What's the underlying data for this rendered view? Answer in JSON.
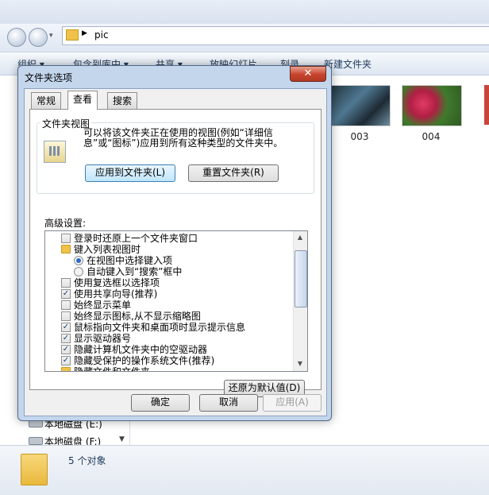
{
  "explorer": {
    "address": "pic",
    "toolbar": [
      "组织 ▾",
      "包含到库中 ▾",
      "共享 ▾",
      "放映幻灯片",
      "刻录",
      "新建文件夹"
    ],
    "thumbnails": [
      {
        "label": "003",
        "color": "#3a5b6e"
      },
      {
        "label": "004",
        "color": "#c22a4a"
      }
    ],
    "nav_items": [
      "本地磁盘 (E:)",
      "本地磁盘 (F:)"
    ],
    "status": "5 个对象"
  },
  "dialog": {
    "title": "文件夹选项",
    "close": "✕",
    "tabs": [
      "常规",
      "查看",
      "搜索"
    ],
    "active_tab": 1,
    "folder_view": {
      "legend": "文件夹视图",
      "description": "可以将该文件夹正在使用的视图(例如“详细信息”或“图标”)应用到所有这种类型的文件夹中。",
      "apply_button": "应用到文件夹(L)",
      "reset_button": "重置文件夹(R)"
    },
    "advanced_label": "高级设置:",
    "tree": [
      {
        "type": "checkbox",
        "checked": false,
        "indent": 0,
        "label": "登录时还原上一个文件夹窗口"
      },
      {
        "type": "folder",
        "indent": 0,
        "label": "键入列表视图时"
      },
      {
        "type": "radio",
        "checked": true,
        "indent": 1,
        "label": "在视图中选择键入项"
      },
      {
        "type": "radio",
        "checked": false,
        "indent": 1,
        "label": "自动键入到“搜索”框中"
      },
      {
        "type": "checkbox",
        "checked": false,
        "indent": 0,
        "label": "使用复选框以选择项"
      },
      {
        "type": "checkbox",
        "checked": true,
        "indent": 0,
        "label": "使用共享向导(推荐)"
      },
      {
        "type": "checkbox",
        "checked": false,
        "indent": 0,
        "label": "始终显示菜单"
      },
      {
        "type": "checkbox",
        "checked": false,
        "indent": 0,
        "label": "始终显示图标,从不显示缩略图"
      },
      {
        "type": "checkbox",
        "checked": true,
        "indent": 0,
        "label": "鼠标指向文件夹和桌面项时显示提示信息"
      },
      {
        "type": "checkbox",
        "checked": true,
        "indent": 0,
        "label": "显示驱动器号"
      },
      {
        "type": "checkbox",
        "checked": true,
        "indent": 0,
        "label": "隐藏计算机文件夹中的空驱动器"
      },
      {
        "type": "checkbox",
        "checked": true,
        "indent": 0,
        "label": "隐藏受保护的操作系统文件(推荐)"
      },
      {
        "type": "folder",
        "indent": 0,
        "label": "隐藏文件和文件夹"
      }
    ],
    "restore_defaults": "还原为默认值(D)",
    "ok": "确定",
    "cancel": "取消",
    "apply": "应用(A)"
  }
}
